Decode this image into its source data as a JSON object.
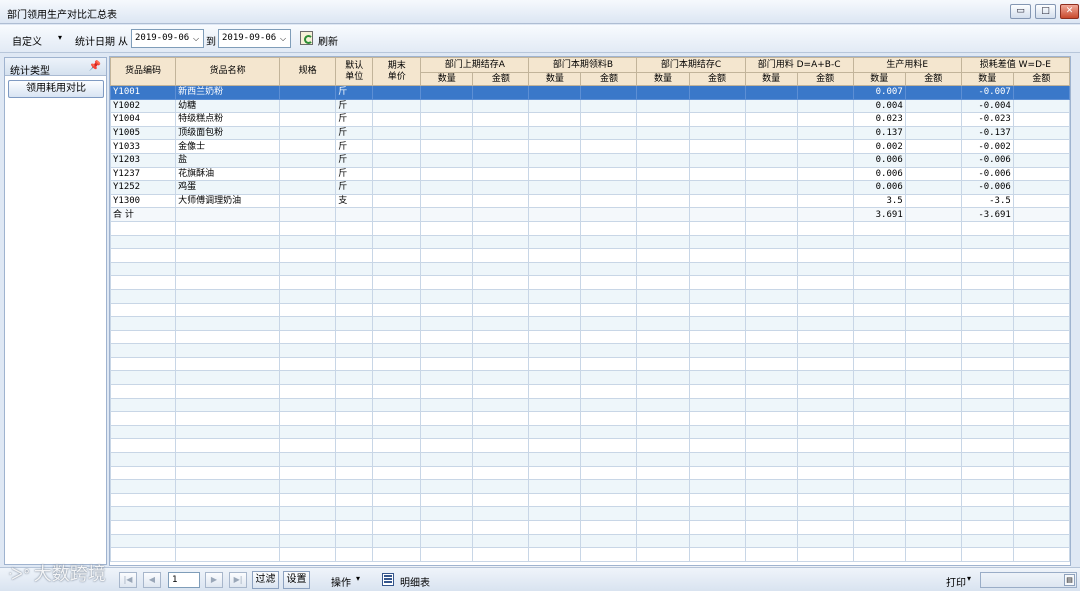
{
  "window": {
    "title": "部门领用生产对比汇总表",
    "min": "▭",
    "max": "□",
    "close": "✕"
  },
  "toolbar": {
    "custom_label": "自定义",
    "custom_arrow": "▾",
    "stat_date_label": "统计日期",
    "from_label": "从",
    "date_from": "2019-09-06",
    "to_label": "到",
    "date_to": "2019-09-06",
    "dropdown_glyph": "⌵",
    "refresh_label": "刷新"
  },
  "left_panel": {
    "title": "统计类型",
    "pin": "📌",
    "items": [
      {
        "label": "领用耗用对比"
      }
    ]
  },
  "grid": {
    "headers": {
      "code": "货品编码",
      "name": "货品名称",
      "spec": "规格",
      "unit_1": "默认",
      "unit_2": "单位",
      "price_1": "期末",
      "price_2": "单价",
      "groups": [
        "部门上期结存A",
        "部门本期领料B",
        "部门本期结存C",
        "部门用料 D=A+B-C",
        "生产用料E",
        "损耗差值 W=D-E"
      ],
      "qty": "数量",
      "amount": "金额"
    },
    "rows": [
      {
        "code": "Y1001",
        "name": "新西兰奶粉",
        "unit": "斤",
        "e_qty": "0.007",
        "w_qty": "-0.007"
      },
      {
        "code": "Y1002",
        "name": "幼糖",
        "unit": "斤",
        "e_qty": "0.004",
        "w_qty": "-0.004"
      },
      {
        "code": "Y1004",
        "name": "特级糕点粉",
        "unit": "斤",
        "e_qty": "0.023",
        "w_qty": "-0.023"
      },
      {
        "code": "Y1005",
        "name": "顶级面包粉",
        "unit": "斤",
        "e_qty": "0.137",
        "w_qty": "-0.137"
      },
      {
        "code": "Y1033",
        "name": "金像士",
        "unit": "斤",
        "e_qty": "0.002",
        "w_qty": "-0.002"
      },
      {
        "code": "Y1203",
        "name": "盐",
        "unit": "斤",
        "e_qty": "0.006",
        "w_qty": "-0.006"
      },
      {
        "code": "Y1237",
        "name": "花旗酥油",
        "unit": "斤",
        "e_qty": "0.006",
        "w_qty": "-0.006"
      },
      {
        "code": "Y1252",
        "name": "鸡蛋",
        "unit": "斤",
        "e_qty": "0.006",
        "w_qty": "-0.006"
      },
      {
        "code": "Y1300",
        "name": "大师傅调理奶油",
        "unit": "支",
        "e_qty": "3.5",
        "w_qty": "-3.5"
      }
    ],
    "total": {
      "label": "合  计",
      "e_qty": "3.691",
      "w_qty": "-3.691"
    },
    "selected_index": 0,
    "empty_rows": 25
  },
  "bottombar": {
    "first": "|◀",
    "prev": "◀",
    "page": "1",
    "next": "▶",
    "last": "▶|",
    "filter": "过滤",
    "settings": "设置",
    "operate": "操作",
    "operate_arrow": "▾",
    "detail": "明细表",
    "print": "打印",
    "print_arrow": "▾",
    "combo_arrow": "▤"
  },
  "watermark": {
    "logo": "ᑀᐤ",
    "text": "大数跨境"
  }
}
